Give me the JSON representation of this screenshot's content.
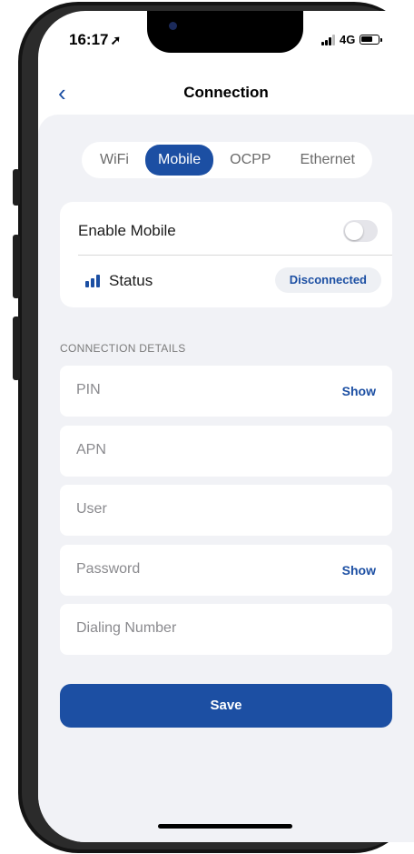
{
  "status_bar": {
    "time": "16:17",
    "location_arrow": "➚",
    "network": "4G"
  },
  "nav": {
    "back_icon": "chevron-left-icon",
    "back_glyph": "‹",
    "title": "Connection"
  },
  "tabs": [
    {
      "label": "WiFi",
      "active": false
    },
    {
      "label": "Mobile",
      "active": true
    },
    {
      "label": "OCPP",
      "active": false
    },
    {
      "label": "Ethernet",
      "active": false
    }
  ],
  "mobile_card": {
    "enable_label": "Enable Mobile",
    "enabled": false,
    "status_label": "Status",
    "status_value": "Disconnected"
  },
  "connection_details": {
    "section_title": "CONNECTION DETAILS",
    "fields": [
      {
        "label": "PIN",
        "action": "Show"
      },
      {
        "label": "APN"
      },
      {
        "label": "User"
      },
      {
        "label": "Password",
        "action": "Show"
      },
      {
        "label": "Dialing Number"
      }
    ]
  },
  "save_label": "Save",
  "colors": {
    "accent": "#1c4fa3",
    "background": "#f1f2f6"
  }
}
